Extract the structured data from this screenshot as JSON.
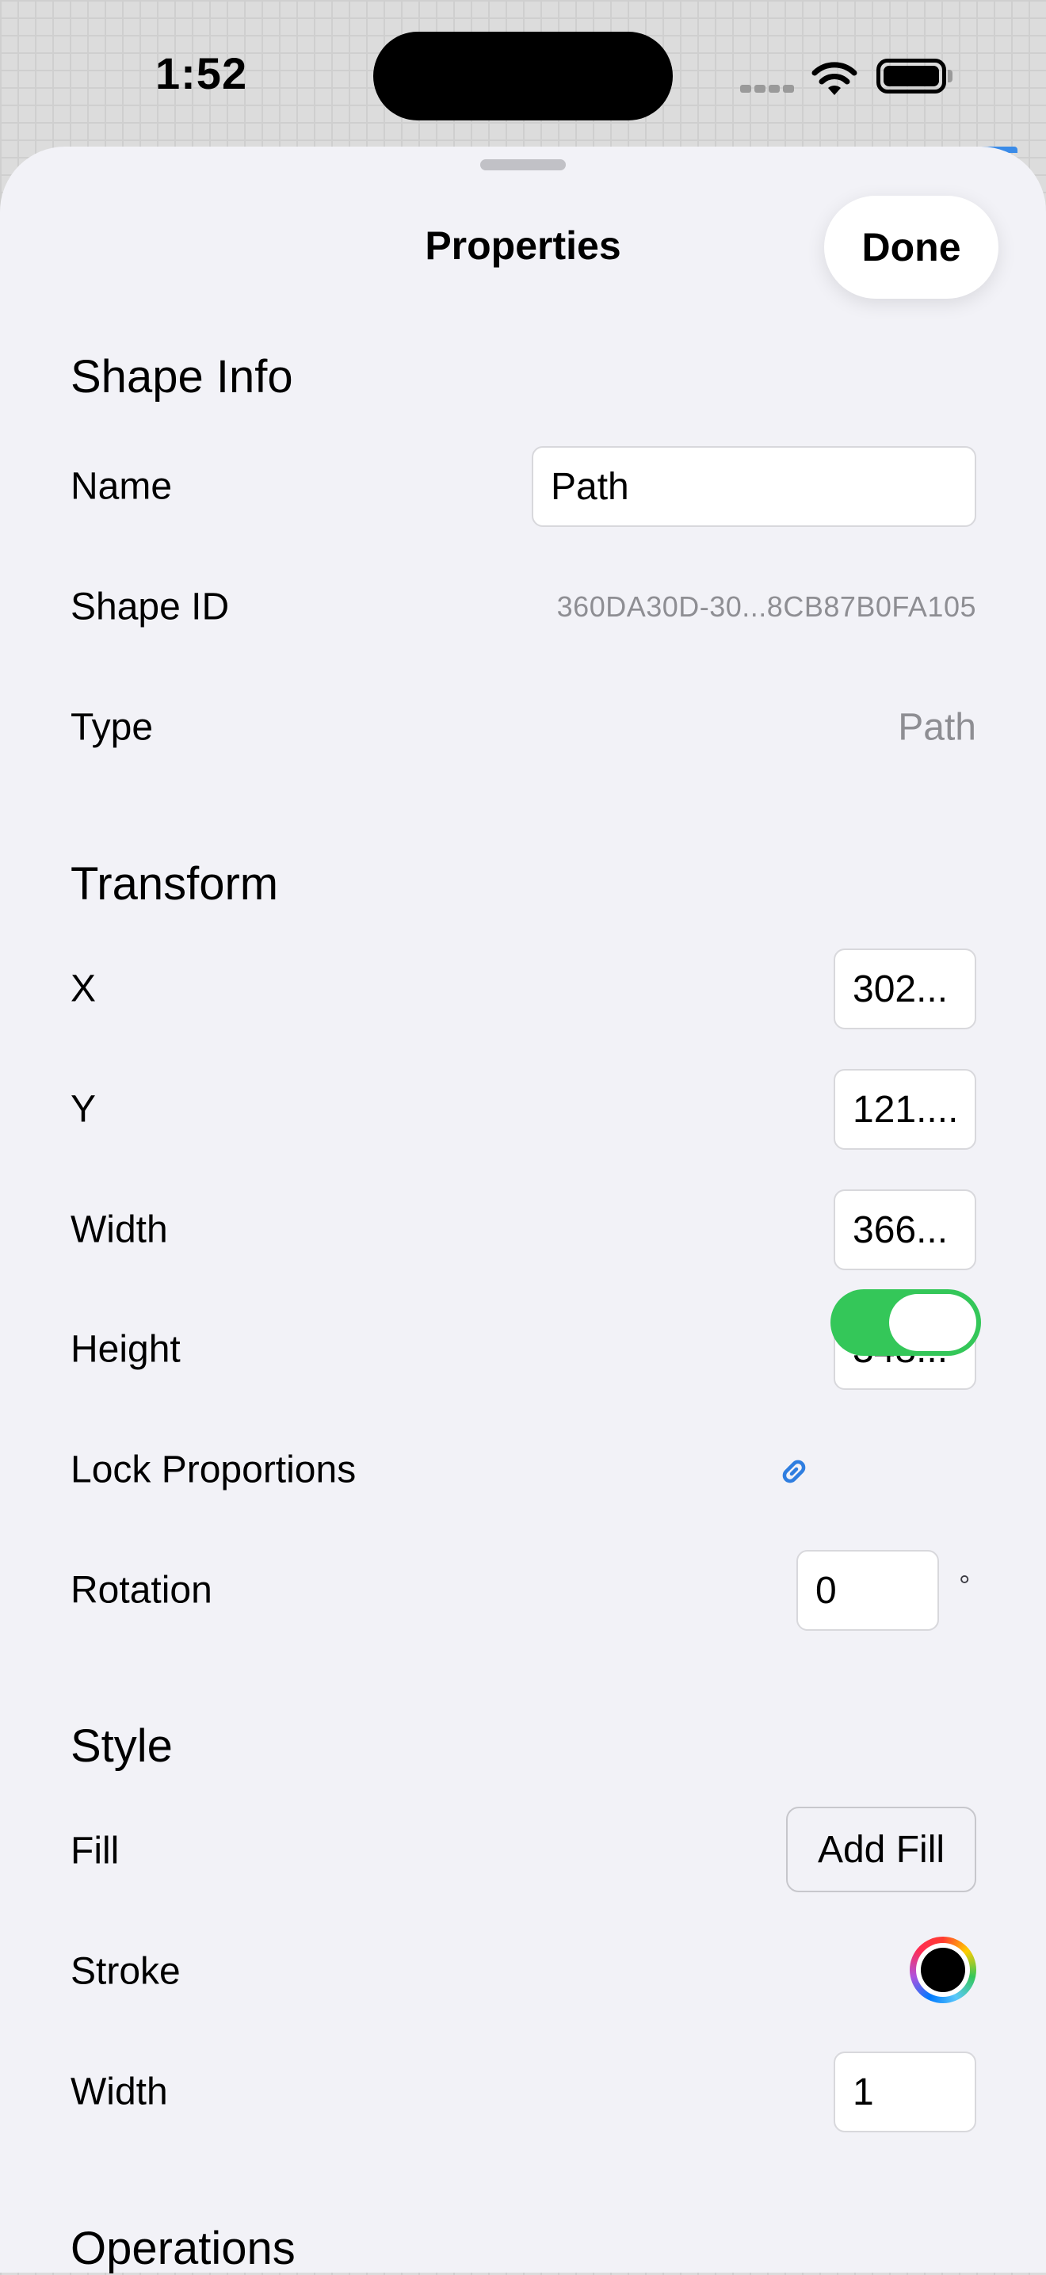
{
  "status_bar": {
    "time": "1:52"
  },
  "sheet": {
    "title": "Properties",
    "done_label": "Done"
  },
  "shape_info": {
    "header": "Shape Info",
    "name_label": "Name",
    "name_value": "Path",
    "shape_id_label": "Shape ID",
    "shape_id_value": "360DA30D-30...8CB87B0FA105",
    "type_label": "Type",
    "type_value": "Path"
  },
  "transform": {
    "header": "Transform",
    "x_label": "X",
    "x_value": "302...",
    "y_label": "Y",
    "y_value": "121....",
    "width_label": "Width",
    "width_value": "366...",
    "height_label": "Height",
    "height_value": "348...",
    "lock_label": "Lock Proportions",
    "lock_on": true,
    "rotation_label": "Rotation",
    "rotation_value": "0",
    "rotation_unit": "°"
  },
  "style": {
    "header": "Style",
    "fill_label": "Fill",
    "add_fill_label": "Add Fill",
    "stroke_label": "Stroke",
    "stroke_color": "#000000",
    "width_label": "Width",
    "width_value": "1"
  },
  "operations": {
    "header": "Operations"
  },
  "colors": {
    "toggle_on": "#34c759",
    "link_icon": "#2f7ee0",
    "sheet_bg": "#f2f2f7"
  },
  "icons": {
    "link": "link-icon",
    "wifi": "wifi-icon",
    "battery": "battery-icon"
  }
}
